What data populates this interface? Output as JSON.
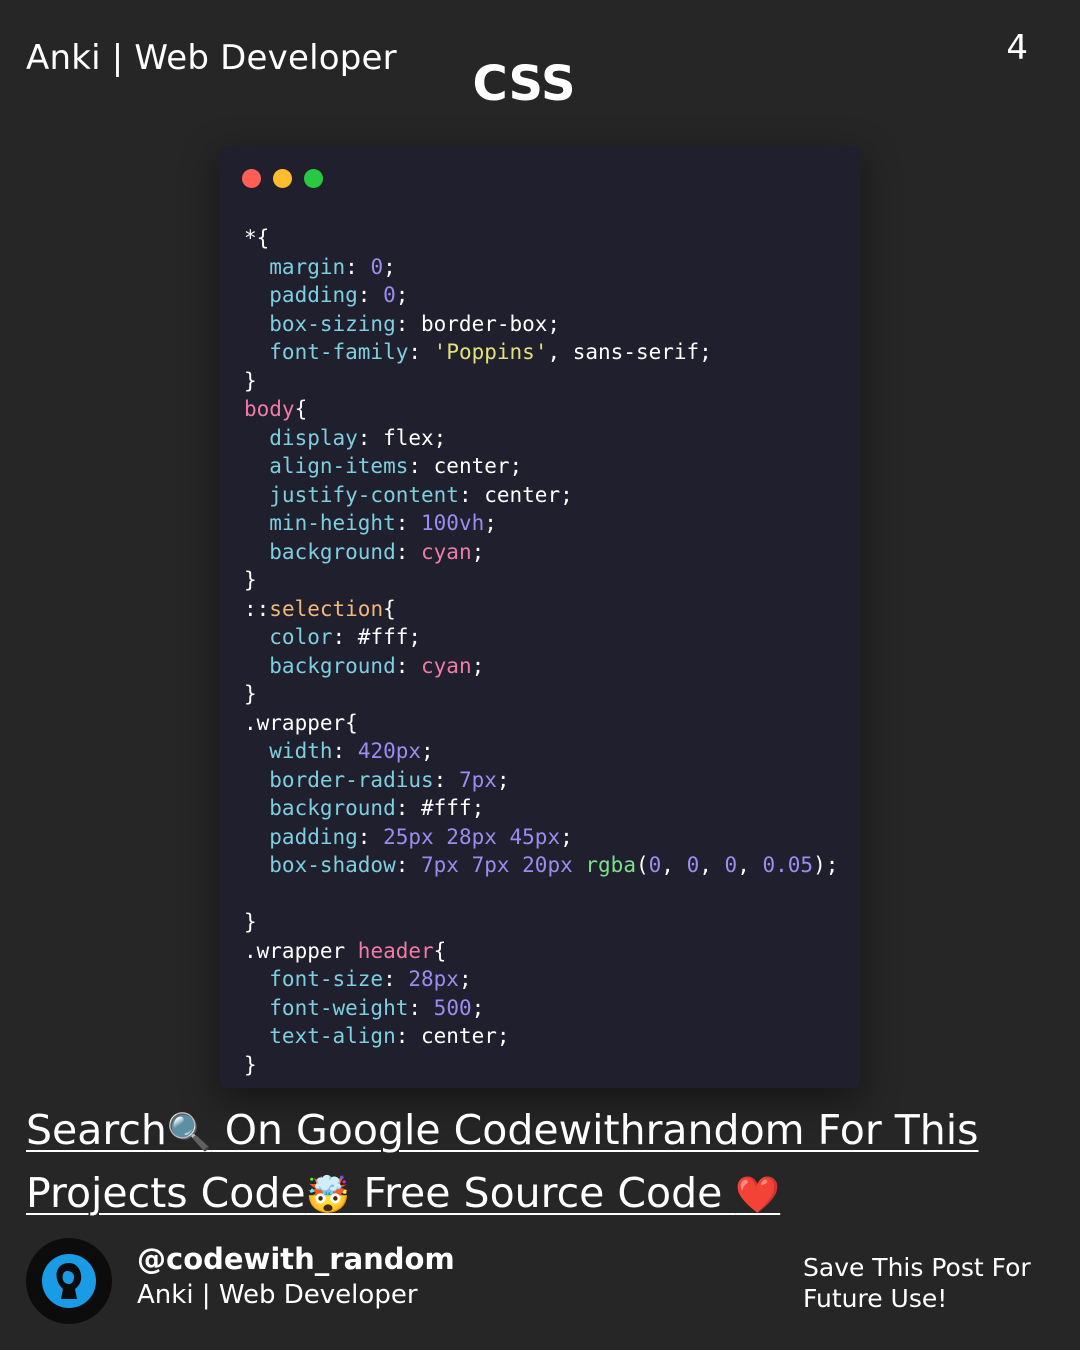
{
  "header": {
    "author": "Anki | Web Developer",
    "page_number": "4",
    "title": "CSS"
  },
  "code_window": {
    "lines": [
      [
        {
          "t": "*{",
          "c": "plain"
        }
      ],
      [
        {
          "t": "  margin",
          "c": "prop"
        },
        {
          "t": ": ",
          "c": "plain"
        },
        {
          "t": "0",
          "c": "num"
        },
        {
          "t": ";",
          "c": "plain"
        }
      ],
      [
        {
          "t": "  padding",
          "c": "prop"
        },
        {
          "t": ": ",
          "c": "plain"
        },
        {
          "t": "0",
          "c": "num"
        },
        {
          "t": ";",
          "c": "plain"
        }
      ],
      [
        {
          "t": "  box-sizing",
          "c": "prop"
        },
        {
          "t": ": border-box;",
          "c": "plain"
        }
      ],
      [
        {
          "t": "  font-family",
          "c": "prop"
        },
        {
          "t": ": ",
          "c": "plain"
        },
        {
          "t": "'Poppins'",
          "c": "str"
        },
        {
          "t": ", sans-serif;",
          "c": "plain"
        }
      ],
      [
        {
          "t": "}",
          "c": "plain"
        }
      ],
      [
        {
          "t": "body",
          "c": "sel"
        },
        {
          "t": "{",
          "c": "plain"
        }
      ],
      [
        {
          "t": "  display",
          "c": "prop"
        },
        {
          "t": ": flex;",
          "c": "plain"
        }
      ],
      [
        {
          "t": "  align-items",
          "c": "prop"
        },
        {
          "t": ": center;",
          "c": "plain"
        }
      ],
      [
        {
          "t": "  justify-content",
          "c": "prop"
        },
        {
          "t": ": center;",
          "c": "plain"
        }
      ],
      [
        {
          "t": "  min-height",
          "c": "prop"
        },
        {
          "t": ": ",
          "c": "plain"
        },
        {
          "t": "100vh",
          "c": "num"
        },
        {
          "t": ";",
          "c": "plain"
        }
      ],
      [
        {
          "t": "  background",
          "c": "prop"
        },
        {
          "t": ": ",
          "c": "plain"
        },
        {
          "t": "cyan",
          "c": "sel"
        },
        {
          "t": ";",
          "c": "plain"
        }
      ],
      [
        {
          "t": "}",
          "c": "plain"
        }
      ],
      [
        {
          "t": "::",
          "c": "plain"
        },
        {
          "t": "selection",
          "c": "pseudo"
        },
        {
          "t": "{",
          "c": "plain"
        }
      ],
      [
        {
          "t": "  color",
          "c": "prop"
        },
        {
          "t": ": #fff;",
          "c": "plain"
        }
      ],
      [
        {
          "t": "  background",
          "c": "prop"
        },
        {
          "t": ": ",
          "c": "plain"
        },
        {
          "t": "cyan",
          "c": "sel"
        },
        {
          "t": ";",
          "c": "plain"
        }
      ],
      [
        {
          "t": "}",
          "c": "plain"
        }
      ],
      [
        {
          "t": ".wrapper{",
          "c": "plain"
        }
      ],
      [
        {
          "t": "  width",
          "c": "prop"
        },
        {
          "t": ": ",
          "c": "plain"
        },
        {
          "t": "420px",
          "c": "num"
        },
        {
          "t": ";",
          "c": "plain"
        }
      ],
      [
        {
          "t": "  border-radius",
          "c": "prop"
        },
        {
          "t": ": ",
          "c": "plain"
        },
        {
          "t": "7px",
          "c": "num"
        },
        {
          "t": ";",
          "c": "plain"
        }
      ],
      [
        {
          "t": "  background",
          "c": "prop"
        },
        {
          "t": ": #fff;",
          "c": "plain"
        }
      ],
      [
        {
          "t": "  padding",
          "c": "prop"
        },
        {
          "t": ": ",
          "c": "plain"
        },
        {
          "t": "25px 28px 45px",
          "c": "num"
        },
        {
          "t": ";",
          "c": "plain"
        }
      ],
      [
        {
          "t": "  box-shadow",
          "c": "prop"
        },
        {
          "t": ": ",
          "c": "plain"
        },
        {
          "t": "7px 7px 20px ",
          "c": "num"
        },
        {
          "t": "rgba",
          "c": "fn"
        },
        {
          "t": "(",
          "c": "plain"
        },
        {
          "t": "0",
          "c": "num"
        },
        {
          "t": ", ",
          "c": "plain"
        },
        {
          "t": "0",
          "c": "num"
        },
        {
          "t": ", ",
          "c": "plain"
        },
        {
          "t": "0",
          "c": "num"
        },
        {
          "t": ", ",
          "c": "plain"
        },
        {
          "t": "0.05",
          "c": "num"
        },
        {
          "t": ");",
          "c": "plain"
        }
      ],
      [
        {
          "t": "",
          "c": "plain"
        }
      ],
      [
        {
          "t": "}",
          "c": "plain"
        }
      ],
      [
        {
          "t": ".wrapper ",
          "c": "plain"
        },
        {
          "t": "header",
          "c": "sel"
        },
        {
          "t": "{",
          "c": "plain"
        }
      ],
      [
        {
          "t": "  font-size",
          "c": "prop"
        },
        {
          "t": ": ",
          "c": "plain"
        },
        {
          "t": "28px",
          "c": "num"
        },
        {
          "t": ";",
          "c": "plain"
        }
      ],
      [
        {
          "t": "  font-weight",
          "c": "prop"
        },
        {
          "t": ": ",
          "c": "plain"
        },
        {
          "t": "500",
          "c": "num"
        },
        {
          "t": ";",
          "c": "plain"
        }
      ],
      [
        {
          "t": "  text-align",
          "c": "prop"
        },
        {
          "t": ": center;",
          "c": "plain"
        }
      ],
      [
        {
          "t": "}",
          "c": "plain"
        }
      ]
    ]
  },
  "cta": {
    "part1": "Search",
    "emoji1": "🔍",
    "part2": " On Google Codewithrandom For This Projects Code",
    "emoji2": "🤯",
    "part3": " Free Source Code ",
    "emoji3": "❤️"
  },
  "footer": {
    "handle": "@codewith_random",
    "author": "Anki | Web Developer",
    "save_line1": "Save This Post For",
    "save_line2": "Future Use!"
  },
  "colors": {
    "background": "#262626",
    "code_bg": "#1f1f2d",
    "property": "#7dcfe0",
    "number": "#9d8cf0",
    "string": "#e6e07a",
    "selector": "#f07ba6",
    "pseudo": "#f0b87a",
    "function": "#7ce08a"
  }
}
